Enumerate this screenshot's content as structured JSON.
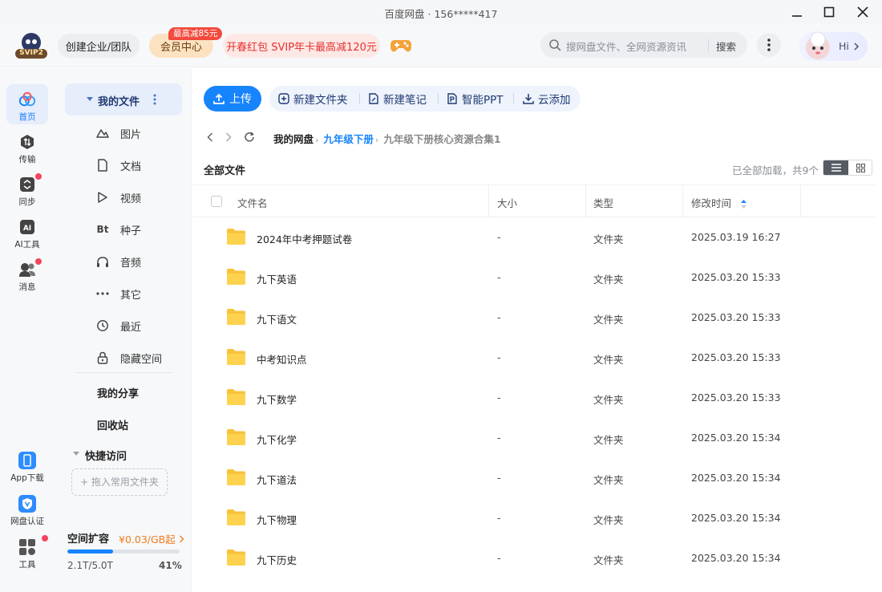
{
  "window": {
    "title": "百度网盘 · 156*****417"
  },
  "header": {
    "logo_text": "SVIP2",
    "enterprise_label": "创建企业/团队",
    "vip_label": "会员中心",
    "vip_badge": "最高减85元",
    "promo_label": "开春红包 SVIP年卡最高减120元",
    "search": {
      "placeholder": "搜网盘文件、全网资源资讯",
      "button": "搜索"
    },
    "user_greeting": "Hi"
  },
  "rail": {
    "items": [
      {
        "label": "首页",
        "icon": "home-cloud-icon"
      },
      {
        "label": "传输",
        "icon": "transfer-icon"
      },
      {
        "label": "同步",
        "icon": "sync-icon"
      },
      {
        "label": "AI工具",
        "icon": "ai-tools-icon"
      },
      {
        "label": "消息",
        "icon": "message-icon"
      }
    ],
    "bottom": [
      {
        "label": "App下载",
        "icon": "app-download-icon"
      },
      {
        "label": "网盘认证",
        "icon": "verify-icon"
      },
      {
        "label": "工具",
        "icon": "tools-icon"
      }
    ]
  },
  "sidebar": {
    "my_files": "我的文件",
    "items": [
      {
        "label": "图片",
        "icon": "image-icon"
      },
      {
        "label": "文档",
        "icon": "document-icon"
      },
      {
        "label": "视频",
        "icon": "video-icon"
      },
      {
        "label": "种子",
        "icon": "bt",
        "icon_text": "Bt"
      },
      {
        "label": "音频",
        "icon": "audio-icon"
      },
      {
        "label": "其它",
        "icon": "other-icon"
      },
      {
        "label": "最近",
        "icon": "recent-icon"
      },
      {
        "label": "隐藏空间",
        "icon": "lock-icon"
      }
    ],
    "my_share": "我的分享",
    "recycle": "回收站",
    "quick_access": "快捷访问",
    "drop_hint": "+ 拖入常用文件夹",
    "storage": {
      "title": "空间扩容",
      "price": "¥0.03/GB起",
      "used_text": "2.1T/5.0T",
      "percent_text": "41%",
      "fraction": 0.41
    }
  },
  "toolbar": {
    "upload": "上传",
    "new_folder": "新建文件夹",
    "new_note": "新建笔记",
    "smart_ppt": "智能PPT",
    "cloud_add": "云添加"
  },
  "breadcrumb": [
    "我的网盘",
    "九年级下册",
    "九年级下册核心资源合集1"
  ],
  "list": {
    "title": "全部文件",
    "loaded_text": "已全部加载，共9个",
    "columns": {
      "name": "文件名",
      "size": "大小",
      "type": "类型",
      "modified": "修改时间"
    },
    "rows": [
      {
        "name": "2024年中考押题试卷",
        "size": "-",
        "type": "文件夹",
        "modified": "2025.03.19 16:27"
      },
      {
        "name": "九下英语",
        "size": "-",
        "type": "文件夹",
        "modified": "2025.03.20 15:33"
      },
      {
        "name": "九下语文",
        "size": "-",
        "type": "文件夹",
        "modified": "2025.03.20 15:33"
      },
      {
        "name": "中考知识点",
        "size": "-",
        "type": "文件夹",
        "modified": "2025.03.20 15:33"
      },
      {
        "name": "九下数学",
        "size": "-",
        "type": "文件夹",
        "modified": "2025.03.20 15:33"
      },
      {
        "name": "九下化学",
        "size": "-",
        "type": "文件夹",
        "modified": "2025.03.20 15:34"
      },
      {
        "name": "九下道法",
        "size": "-",
        "type": "文件夹",
        "modified": "2025.03.20 15:34"
      },
      {
        "name": "九下物理",
        "size": "-",
        "type": "文件夹",
        "modified": "2025.03.20 15:34"
      },
      {
        "name": "九下历史",
        "size": "-",
        "type": "文件夹",
        "modified": "2025.03.20 15:34"
      }
    ]
  },
  "colors": {
    "accent": "#1684fc",
    "folder": "#f8c33a",
    "badge": "#f24a3d",
    "promo": "#e5322d"
  }
}
